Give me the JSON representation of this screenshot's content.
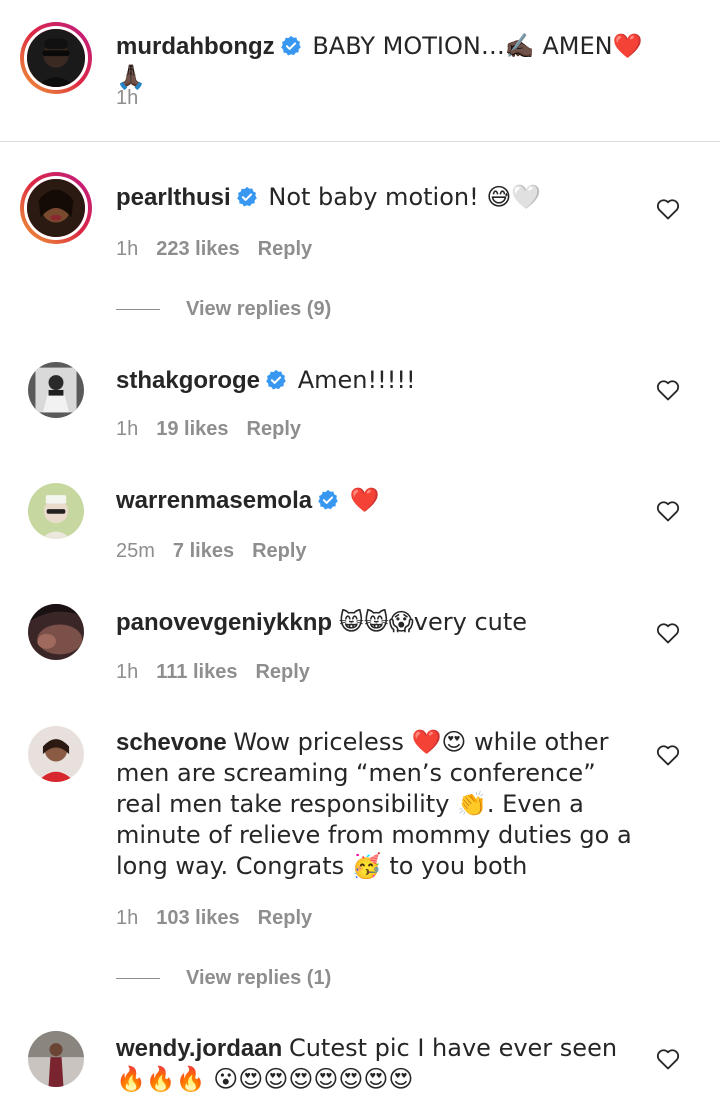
{
  "caption": {
    "username": "murdahbongz",
    "text": "BABY MOTION…✍🏿 AMEN❤️🙏🏿",
    "time": "1h"
  },
  "comments": [
    {
      "username": "pearlthusi",
      "verified": true,
      "text": "Not baby motion! 😅🤍",
      "time": "1h",
      "likes": "223 likes",
      "reply": "Reply",
      "view_replies": "View replies (9)"
    },
    {
      "username": "sthakgoroge",
      "verified": true,
      "text": "Amen!!!!!",
      "time": "1h",
      "likes": "19 likes",
      "reply": "Reply"
    },
    {
      "username": "warrenmasemola",
      "verified": true,
      "text": "❤️",
      "time": "25m",
      "likes": "7 likes",
      "reply": "Reply"
    },
    {
      "username": "panovevgeniykknp",
      "verified": false,
      "text": "😸😸😱very cute",
      "time": "1h",
      "likes": "111 likes",
      "reply": "Reply"
    },
    {
      "username": "schevone",
      "verified": false,
      "text": "Wow priceless ❤️😍 while other men are screaming “men’s conference” real men take responsibility 👏. Even a minute of relieve from mommy duties go a long way. Congrats 🥳 to you both",
      "time": "1h",
      "likes": "103 likes",
      "reply": "Reply",
      "view_replies": "View replies (1)"
    },
    {
      "username": "wendy.jordaan",
      "verified": false,
      "text": "Cutest pic I have ever seen🔥🔥🔥 😮😍😍😍😍😍😍😍"
    }
  ],
  "colors": {
    "verified": "#3897f0",
    "meta": "#8e8e8e",
    "text": "#262626"
  }
}
